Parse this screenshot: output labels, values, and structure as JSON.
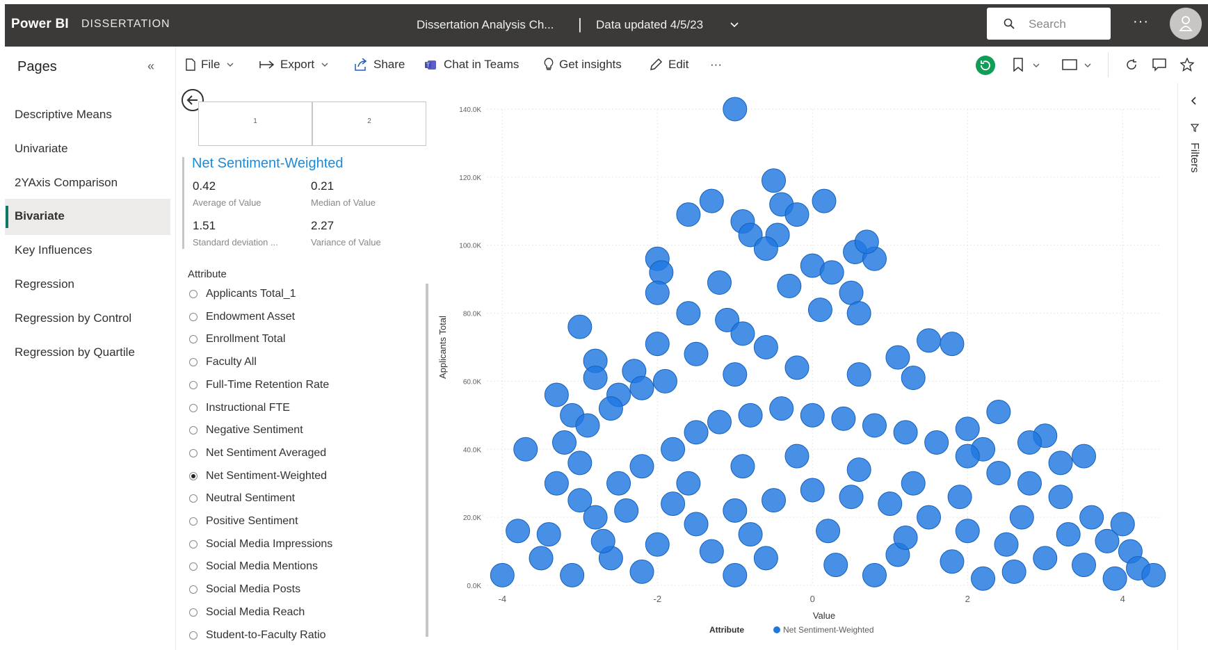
{
  "topbar": {
    "brand": "Power BI",
    "workspace": "DISSERTATION",
    "report_title": "Dissertation Analysis Ch...",
    "separator": "|",
    "data_updated": "Data updated 4/5/23",
    "search_placeholder": "Search",
    "more": "···"
  },
  "pages_pane": {
    "title": "Pages",
    "collapse": "«",
    "items": [
      {
        "label": "Descriptive Means"
      },
      {
        "label": "Univariate"
      },
      {
        "label": "2YAxis Comparison"
      },
      {
        "label": "Bivariate",
        "active": true
      },
      {
        "label": "Key Influences"
      },
      {
        "label": "Regression"
      },
      {
        "label": "Regression by Control"
      },
      {
        "label": "Regression by Quartile"
      }
    ]
  },
  "toolbar": {
    "file": "File",
    "export": "Export",
    "share": "Share",
    "chat": "Chat in Teams",
    "insights": "Get insights",
    "edit": "Edit",
    "more": "···"
  },
  "visual": {
    "cards": [
      "1",
      "2"
    ],
    "kpi": {
      "title": "Net Sentiment-Weighted",
      "stats": [
        {
          "value": "0.42",
          "label": "Average of Value"
        },
        {
          "value": "0.21",
          "label": "Median of Value"
        },
        {
          "value": "1.51",
          "label": "Standard deviation ..."
        },
        {
          "value": "2.27",
          "label": "Variance of Value"
        }
      ]
    },
    "slicer": {
      "title": "Attribute",
      "options": [
        {
          "label": "Applicants Total_1"
        },
        {
          "label": "Endowment Asset"
        },
        {
          "label": "Enrollment Total"
        },
        {
          "label": "Faculty All"
        },
        {
          "label": "Full-Time Retention Rate"
        },
        {
          "label": "Instructional FTE"
        },
        {
          "label": "Negative Sentiment"
        },
        {
          "label": "Net Sentiment Averaged"
        },
        {
          "label": "Net Sentiment-Weighted",
          "selected": true
        },
        {
          "label": "Neutral Sentiment"
        },
        {
          "label": "Positive Sentiment"
        },
        {
          "label": "Social Media Impressions"
        },
        {
          "label": "Social Media Mentions"
        },
        {
          "label": "Social Media Posts"
        },
        {
          "label": "Social Media Reach"
        },
        {
          "label": "Student-to-Faculty Ratio"
        }
      ]
    }
  },
  "filters_pane": {
    "label": "Filters"
  },
  "colors": {
    "accent": "#1e8ad6",
    "topbar": "#3b3a39",
    "marker": "#1f78e0",
    "marker_stroke": "#1560bd",
    "active_indicator": "#117865"
  },
  "chart_data": {
    "type": "scatter",
    "xlabel": "Value",
    "ylabel": "Applicants Total",
    "xlim": [
      -4.2,
      4.5
    ],
    "ylim": [
      0,
      140000
    ],
    "x_ticks": [
      "-4",
      "-2",
      "0",
      "2",
      "4"
    ],
    "y_ticks": [
      "0.0K",
      "20.0K",
      "40.0K",
      "60.0K",
      "80.0K",
      "100.0K",
      "120.0K",
      "140.0K"
    ],
    "legend": {
      "title": "Attribute",
      "series_name": "Net Sentiment-Weighted",
      "placement": "bottom"
    },
    "grid": true,
    "series": [
      {
        "name": "Net Sentiment-Weighted",
        "points": [
          [
            -1.0,
            140000
          ],
          [
            -0.5,
            119000
          ],
          [
            0.15,
            113000
          ],
          [
            -1.3,
            113000
          ],
          [
            -0.4,
            112000
          ],
          [
            -1.6,
            109000
          ],
          [
            -0.2,
            109000
          ],
          [
            -0.9,
            107000
          ],
          [
            -0.45,
            103000
          ],
          [
            0.55,
            98000
          ],
          [
            0.8,
            96000
          ],
          [
            0.7,
            101000
          ],
          [
            -2.0,
            96000
          ],
          [
            -0.8,
            103000
          ],
          [
            -0.6,
            99000
          ],
          [
            0.0,
            94000
          ],
          [
            0.25,
            92000
          ],
          [
            -1.95,
            92000
          ],
          [
            -2.0,
            86000
          ],
          [
            -1.2,
            89000
          ],
          [
            -0.3,
            88000
          ],
          [
            0.5,
            86000
          ],
          [
            -1.6,
            80000
          ],
          [
            -1.1,
            78000
          ],
          [
            0.1,
            81000
          ],
          [
            0.6,
            80000
          ],
          [
            -0.9,
            74000
          ],
          [
            -3.0,
            76000
          ],
          [
            1.5,
            72000
          ],
          [
            1.8,
            71000
          ],
          [
            -2.0,
            71000
          ],
          [
            -2.8,
            66000
          ],
          [
            -2.3,
            63000
          ],
          [
            1.1,
            67000
          ],
          [
            -1.5,
            68000
          ],
          [
            -0.6,
            70000
          ],
          [
            -3.3,
            56000
          ],
          [
            -2.8,
            61000
          ],
          [
            -2.5,
            56000
          ],
          [
            -2.2,
            58000
          ],
          [
            -1.9,
            60000
          ],
          [
            -1.0,
            62000
          ],
          [
            -0.2,
            64000
          ],
          [
            0.6,
            62000
          ],
          [
            1.3,
            61000
          ],
          [
            -3.7,
            40000
          ],
          [
            -3.1,
            50000
          ],
          [
            -2.9,
            47000
          ],
          [
            -2.6,
            52000
          ],
          [
            2.4,
            51000
          ],
          [
            2.0,
            46000
          ],
          [
            3.0,
            44000
          ],
          [
            3.5,
            38000
          ],
          [
            2.8,
            42000
          ],
          [
            2.2,
            40000
          ],
          [
            3.2,
            36000
          ],
          [
            -3.2,
            42000
          ],
          [
            -3.0,
            36000
          ],
          [
            -3.3,
            30000
          ],
          [
            -3.4,
            15000
          ],
          [
            -3.8,
            16000
          ],
          [
            -3.0,
            25000
          ],
          [
            -2.8,
            20000
          ],
          [
            -2.5,
            30000
          ],
          [
            -2.2,
            35000
          ],
          [
            -1.8,
            40000
          ],
          [
            -1.5,
            45000
          ],
          [
            -1.2,
            48000
          ],
          [
            -0.8,
            50000
          ],
          [
            -0.4,
            52000
          ],
          [
            0.0,
            50000
          ],
          [
            0.4,
            49000
          ],
          [
            0.8,
            47000
          ],
          [
            1.2,
            45000
          ],
          [
            1.6,
            42000
          ],
          [
            2.0,
            38000
          ],
          [
            2.4,
            33000
          ],
          [
            2.8,
            30000
          ],
          [
            3.2,
            26000
          ],
          [
            3.6,
            20000
          ],
          [
            4.0,
            18000
          ],
          [
            3.8,
            13000
          ],
          [
            4.1,
            10000
          ],
          [
            4.2,
            5000
          ],
          [
            4.4,
            3000
          ],
          [
            -4.0,
            3000
          ],
          [
            -3.1,
            3000
          ],
          [
            -2.6,
            8000
          ],
          [
            -2.0,
            12000
          ],
          [
            -1.5,
            18000
          ],
          [
            -1.0,
            22000
          ],
          [
            -0.5,
            25000
          ],
          [
            0.0,
            28000
          ],
          [
            0.5,
            26000
          ],
          [
            1.0,
            24000
          ],
          [
            1.5,
            20000
          ],
          [
            2.0,
            16000
          ],
          [
            2.5,
            12000
          ],
          [
            3.0,
            8000
          ],
          [
            3.5,
            6000
          ],
          [
            -1.6,
            30000
          ],
          [
            -0.9,
            35000
          ],
          [
            -0.2,
            38000
          ],
          [
            0.6,
            34000
          ],
          [
            1.3,
            30000
          ],
          [
            1.9,
            26000
          ],
          [
            -2.4,
            22000
          ],
          [
            -1.3,
            10000
          ],
          [
            -0.6,
            8000
          ],
          [
            0.3,
            6000
          ],
          [
            1.1,
            9000
          ],
          [
            1.8,
            7000
          ],
          [
            2.6,
            4000
          ],
          [
            -3.5,
            8000
          ],
          [
            -2.2,
            4000
          ],
          [
            -1.0,
            3000
          ],
          [
            0.8,
            3000
          ],
          [
            2.2,
            2000
          ],
          [
            3.9,
            2000
          ],
          [
            -0.8,
            15000
          ],
          [
            0.2,
            16000
          ],
          [
            1.2,
            14000
          ],
          [
            -1.8,
            24000
          ],
          [
            2.7,
            20000
          ],
          [
            -2.7,
            13000
          ],
          [
            3.3,
            15000
          ]
        ]
      }
    ]
  }
}
